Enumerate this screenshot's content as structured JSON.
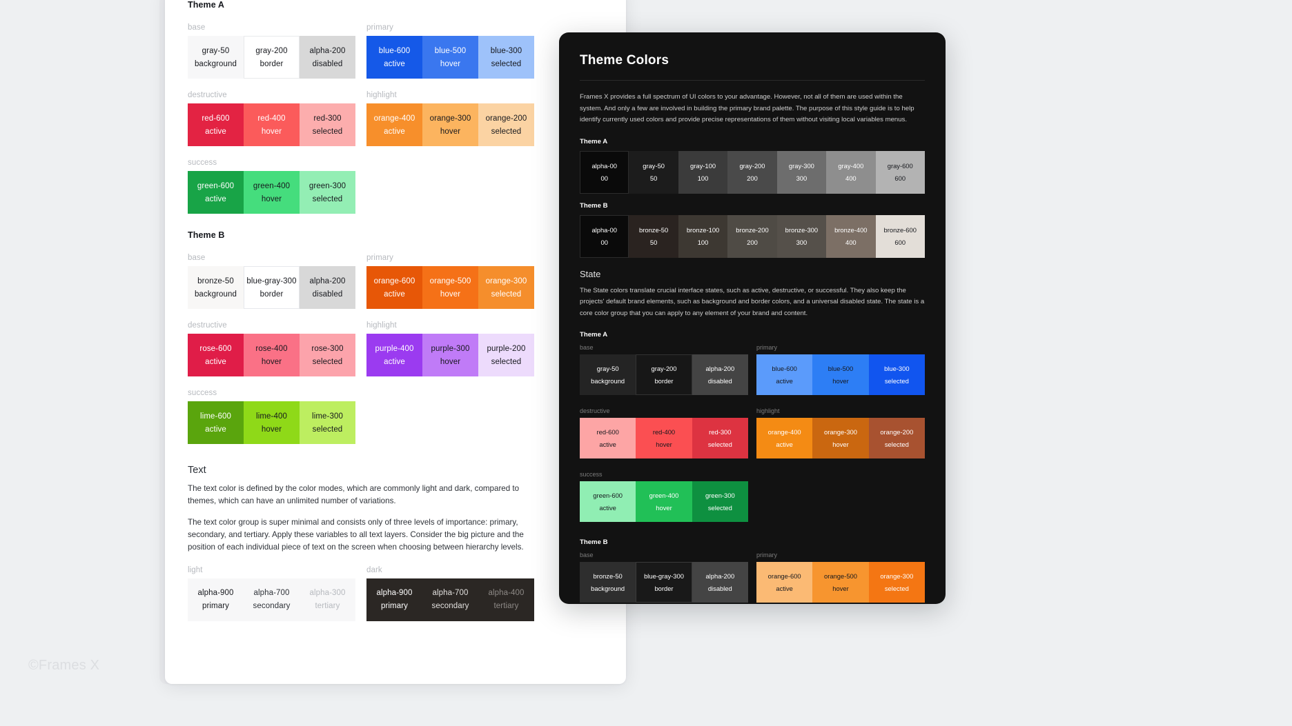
{
  "watermark": "©Frames X",
  "light_panel": {
    "theme_a": {
      "title": "Theme A",
      "groups": [
        {
          "label": "base",
          "side": "left",
          "swatches": [
            {
              "name": "gray-50",
              "role": "background",
              "bg": "#f7f7f8",
              "fg": "#16181d",
              "border": "none"
            },
            {
              "name": "gray-200",
              "role": "border",
              "bg": "#ffffff",
              "fg": "#16181d",
              "border": "#e8e9eb"
            },
            {
              "name": "alpha-200",
              "role": "disabled",
              "bg": "#d8d8d8",
              "fg": "#16181d",
              "border": "none"
            }
          ]
        },
        {
          "label": "primary",
          "side": "right",
          "swatches": [
            {
              "name": "blue-600",
              "role": "active",
              "bg": "#1559e8",
              "fg": "#ffffff",
              "border": "none"
            },
            {
              "name": "blue-500",
              "role": "hover",
              "bg": "#3a77ef",
              "fg": "#ffffff",
              "border": "none"
            },
            {
              "name": "blue-300",
              "role": "selected",
              "bg": "#9ec2fa",
              "fg": "#16181d",
              "border": "none"
            }
          ]
        },
        {
          "label": "destructive",
          "side": "left",
          "swatches": [
            {
              "name": "red-600",
              "role": "active",
              "bg": "#e32343",
              "fg": "#ffffff",
              "border": "none"
            },
            {
              "name": "red-400",
              "role": "hover",
              "bg": "#fb5b5b",
              "fg": "#ffffff",
              "border": "none"
            },
            {
              "name": "red-300",
              "role": "selected",
              "bg": "#fcadad",
              "fg": "#16181d",
              "border": "none"
            }
          ]
        },
        {
          "label": "highlight",
          "side": "right",
          "swatches": [
            {
              "name": "orange-400",
              "role": "active",
              "bg": "#f78f2b",
              "fg": "#ffffff",
              "border": "none"
            },
            {
              "name": "orange-300",
              "role": "hover",
              "bg": "#fcb45f",
              "fg": "#16181d",
              "border": "none"
            },
            {
              "name": "orange-200",
              "role": "selected",
              "bg": "#fbd3a3",
              "fg": "#16181d",
              "border": "none"
            }
          ]
        },
        {
          "label": "success",
          "side": "left",
          "swatches": [
            {
              "name": "green-600",
              "role": "active",
              "bg": "#18a447",
              "fg": "#ffffff",
              "border": "none"
            },
            {
              "name": "green-400",
              "role": "hover",
              "bg": "#45dd7d",
              "fg": "#16181d",
              "border": "none"
            },
            {
              "name": "green-300",
              "role": "selected",
              "bg": "#93eeb4",
              "fg": "#16181d",
              "border": "none"
            }
          ]
        }
      ]
    },
    "theme_b": {
      "title": "Theme B",
      "groups": [
        {
          "label": "base",
          "side": "left",
          "swatches": [
            {
              "name": "bronze-50",
              "role": "background",
              "bg": "#f8f7f6",
              "fg": "#16181d",
              "border": "none"
            },
            {
              "name": "blue-gray-300",
              "role": "border",
              "bg": "#ffffff",
              "fg": "#16181d",
              "border": "#e6e8ec"
            },
            {
              "name": "alpha-200",
              "role": "disabled",
              "bg": "#d8d8d8",
              "fg": "#16181d",
              "border": "none"
            }
          ]
        },
        {
          "label": "primary",
          "side": "right",
          "swatches": [
            {
              "name": "orange-600",
              "role": "active",
              "bg": "#e75707",
              "fg": "#ffffff",
              "border": "none"
            },
            {
              "name": "orange-500",
              "role": "hover",
              "bg": "#f57117",
              "fg": "#ffffff",
              "border": "none"
            },
            {
              "name": "orange-300",
              "role": "selected",
              "bg": "#f58e2c",
              "fg": "#ffffff",
              "border": "none"
            }
          ]
        },
        {
          "label": "destructive",
          "side": "left",
          "swatches": [
            {
              "name": "rose-600",
              "role": "active",
              "bg": "#e01d48",
              "fg": "#ffffff",
              "border": "none"
            },
            {
              "name": "rose-400",
              "role": "hover",
              "bg": "#fa7186",
              "fg": "#16181d",
              "border": "none"
            },
            {
              "name": "rose-300",
              "role": "selected",
              "bg": "#fca3ab",
              "fg": "#16181d",
              "border": "none"
            }
          ]
        },
        {
          "label": "highlight",
          "side": "right",
          "swatches": [
            {
              "name": "purple-400",
              "role": "active",
              "bg": "#9b3bf0",
              "fg": "#ffffff",
              "border": "none"
            },
            {
              "name": "purple-300",
              "role": "hover",
              "bg": "#c07bf7",
              "fg": "#16181d",
              "border": "none"
            },
            {
              "name": "purple-200",
              "role": "selected",
              "bg": "#eddbfc",
              "fg": "#16181d",
              "border": "none"
            }
          ]
        },
        {
          "label": "success",
          "side": "left",
          "swatches": [
            {
              "name": "lime-600",
              "role": "active",
              "bg": "#5aa50d",
              "fg": "#ffffff",
              "border": "none"
            },
            {
              "name": "lime-400",
              "role": "hover",
              "bg": "#8fd918",
              "fg": "#16181d",
              "border": "none"
            },
            {
              "name": "lime-300",
              "role": "selected",
              "bg": "#bdee60",
              "fg": "#16181d",
              "border": "none"
            }
          ]
        }
      ]
    },
    "text_section": {
      "heading": "Text",
      "paragraph1": "The text color is defined by the color modes, which are commonly light and dark, compared to themes, which can have an unlimited number of variations.",
      "paragraph2": "The text color group is super minimal and consists only of three levels of importance: primary, secondary, and tertiary. Apply these variables to all text layers. Consider the big picture and the position of each individual piece of text on the screen when choosing between hierarchy levels.",
      "light": {
        "label": "light",
        "bg": "#f7f7f8",
        "swatches": [
          {
            "name": "alpha-900",
            "role": "primary",
            "fg": "#16181d"
          },
          {
            "name": "alpha-700",
            "role": "secondary",
            "fg": "#2e3238"
          },
          {
            "name": "alpha-300",
            "role": "tertiary",
            "fg": "#b6b9be"
          }
        ]
      },
      "dark": {
        "label": "dark",
        "bg": "#2b2724",
        "swatches": [
          {
            "name": "alpha-900",
            "role": "primary",
            "fg": "#ffffff"
          },
          {
            "name": "alpha-700",
            "role": "secondary",
            "fg": "#e2e0de"
          },
          {
            "name": "alpha-400",
            "role": "tertiary",
            "fg": "#8d8986"
          }
        ]
      }
    }
  },
  "dark_panel": {
    "title": "Theme Colors",
    "intro": "Frames X provides a full spectrum of UI colors to your advantage. However, not all of them are used within the system. And only a few are involved in building the primary brand palette. The purpose of this style guide is to help identify currently used colors and provide precise representations of them without visiting local variables menus.",
    "theme_a": {
      "title": "Theme A",
      "swatches": [
        {
          "name": "alpha-00",
          "value": "00",
          "bg": "#0a0a0a",
          "fg": "#ffffff",
          "border": "#2c2c2c"
        },
        {
          "name": "gray-50",
          "value": "50",
          "bg": "#1c1c1c",
          "fg": "#ffffff",
          "border": "none"
        },
        {
          "name": "gray-100",
          "value": "100",
          "bg": "#3b3b3b",
          "fg": "#ffffff",
          "border": "none"
        },
        {
          "name": "gray-200",
          "value": "200",
          "bg": "#4a4a4a",
          "fg": "#ffffff",
          "border": "none"
        },
        {
          "name": "gray-300",
          "value": "300",
          "bg": "#6d6d6d",
          "fg": "#ffffff",
          "border": "none"
        },
        {
          "name": "gray-400",
          "value": "400",
          "bg": "#8e8e8e",
          "fg": "#ffffff",
          "border": "none"
        },
        {
          "name": "gray-600",
          "value": "600",
          "bg": "#b3b3b3",
          "fg": "#16181d",
          "border": "none"
        }
      ]
    },
    "theme_b": {
      "title": "Theme B",
      "swatches": [
        {
          "name": "alpha-00",
          "value": "00",
          "bg": "#0a0a0a",
          "fg": "#ffffff",
          "border": "#2c2c2c"
        },
        {
          "name": "bronze-50",
          "value": "50",
          "bg": "#2a2320",
          "fg": "#ffffff",
          "border": "none"
        },
        {
          "name": "bronze-100",
          "value": "100",
          "bg": "#3d3832",
          "fg": "#ffffff",
          "border": "none"
        },
        {
          "name": "bronze-200",
          "value": "200",
          "bg": "#4f4b45",
          "fg": "#ffffff",
          "border": "none"
        },
        {
          "name": "bronze-300",
          "value": "300",
          "bg": "#55504a",
          "fg": "#ffffff",
          "border": "none"
        },
        {
          "name": "bronze-400",
          "value": "400",
          "bg": "#7c6f65",
          "fg": "#ffffff",
          "border": "none"
        },
        {
          "name": "bronze-600",
          "value": "600",
          "bg": "#e3ded8",
          "fg": "#16181d",
          "border": "none"
        }
      ]
    },
    "state": {
      "heading": "State",
      "paragraph": "The State colors translate crucial interface states, such as active, destructive, or successful. They also keep the projects' default brand elements, such as background and border colors, and a universal disabled state. The state is a core color group that you can apply to any element of your brand and content.",
      "theme_a": {
        "title": "Theme A",
        "groups": [
          {
            "label": "base",
            "side": "left",
            "swatches": [
              {
                "name": "gray-50",
                "role": "background",
                "bg": "#242424",
                "fg": "#ffffff",
                "border": "none"
              },
              {
                "name": "gray-200",
                "role": "border",
                "bg": "#171717",
                "fg": "#ffffff",
                "border": "#333333"
              },
              {
                "name": "alpha-200",
                "role": "disabled",
                "bg": "#444444",
                "fg": "#ffffff",
                "border": "none"
              }
            ]
          },
          {
            "label": "primary",
            "side": "right",
            "swatches": [
              {
                "name": "blue-600",
                "role": "active",
                "bg": "#5b9bfb",
                "fg": "#16181d",
                "border": "none"
              },
              {
                "name": "blue-500",
                "role": "hover",
                "bg": "#2d7ef5",
                "fg": "#16181d",
                "border": "none"
              },
              {
                "name": "blue-300",
                "role": "selected",
                "bg": "#1155ef",
                "fg": "#ffffff",
                "border": "none"
              }
            ]
          },
          {
            "label": "destructive",
            "side": "left",
            "swatches": [
              {
                "name": "red-600",
                "role": "active",
                "bg": "#fda5a5",
                "fg": "#16181d",
                "border": "none"
              },
              {
                "name": "red-400",
                "role": "hover",
                "bg": "#fb4f52",
                "fg": "#16181d",
                "border": "none"
              },
              {
                "name": "red-300",
                "role": "selected",
                "bg": "#dd3341",
                "fg": "#ffffff",
                "border": "none"
              }
            ]
          },
          {
            "label": "highlight",
            "side": "right",
            "swatches": [
              {
                "name": "orange-400",
                "role": "active",
                "bg": "#f48b14",
                "fg": "#ffffff",
                "border": "none"
              },
              {
                "name": "orange-300",
                "role": "hover",
                "bg": "#ca6710",
                "fg": "#ffffff",
                "border": "none"
              },
              {
                "name": "orange-200",
                "role": "selected",
                "bg": "#a85230",
                "fg": "#ffffff",
                "border": "none"
              }
            ]
          },
          {
            "label": "success",
            "side": "left",
            "swatches": [
              {
                "name": "green-600",
                "role": "active",
                "bg": "#90eeb3",
                "fg": "#16181d",
                "border": "none"
              },
              {
                "name": "green-400",
                "role": "hover",
                "bg": "#21c057",
                "fg": "#ffffff",
                "border": "none"
              },
              {
                "name": "green-300",
                "role": "selected",
                "bg": "#0e9040",
                "fg": "#ffffff",
                "border": "none"
              }
            ]
          }
        ]
      },
      "theme_b": {
        "title": "Theme B",
        "groups": [
          {
            "label": "base",
            "side": "left",
            "swatches": [
              {
                "name": "bronze-50",
                "role": "background",
                "bg": "#2e2e2e",
                "fg": "#ffffff",
                "border": "none"
              },
              {
                "name": "blue-gray-300",
                "role": "border",
                "bg": "#191919",
                "fg": "#ffffff",
                "border": "#3a3a3a"
              },
              {
                "name": "alpha-200",
                "role": "disabled",
                "bg": "#444444",
                "fg": "#ffffff",
                "border": "none"
              }
            ]
          },
          {
            "label": "primary",
            "side": "right",
            "swatches": [
              {
                "name": "orange-600",
                "role": "active",
                "bg": "#fbba74",
                "fg": "#16181d",
                "border": "none"
              },
              {
                "name": "orange-500",
                "role": "hover",
                "bg": "#f7952f",
                "fg": "#16181d",
                "border": "none"
              },
              {
                "name": "orange-300",
                "role": "selected",
                "bg": "#f47613",
                "fg": "#ffffff",
                "border": "none"
              }
            ]
          }
        ]
      }
    }
  }
}
